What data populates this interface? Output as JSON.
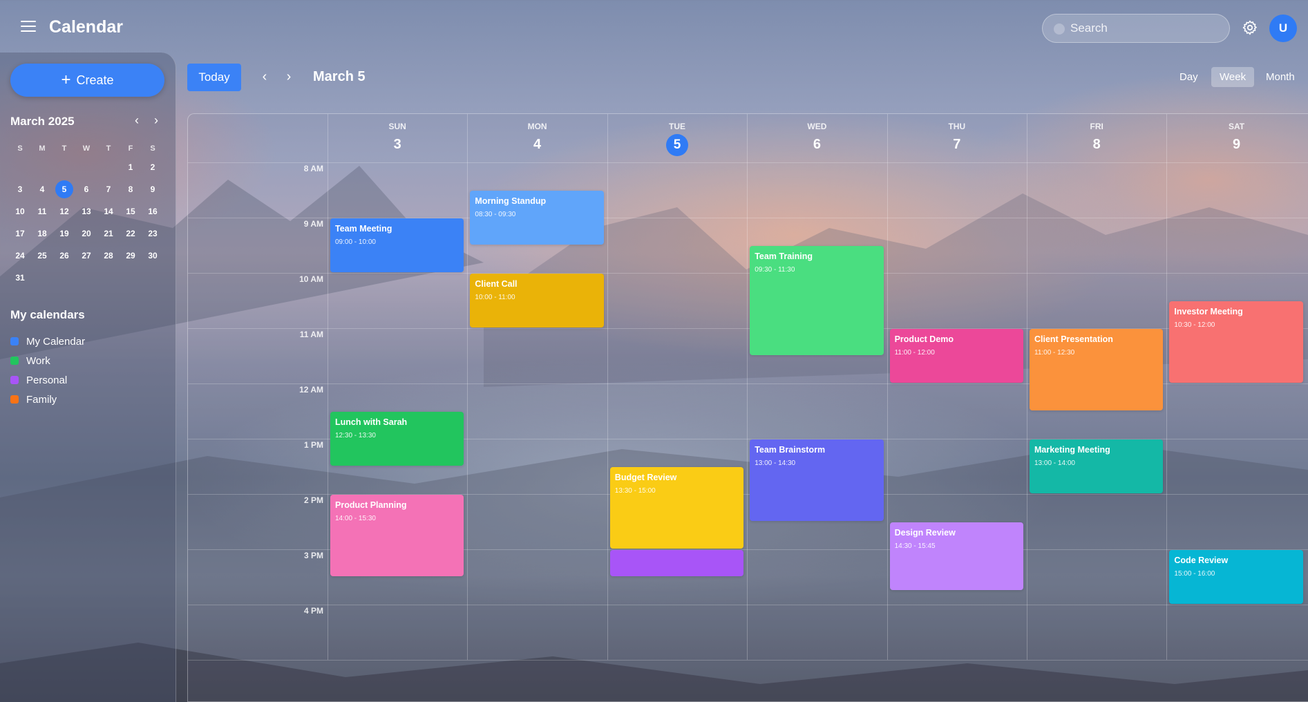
{
  "header": {
    "title": "Calendar",
    "search_placeholder": "Search",
    "avatar_initial": "U"
  },
  "sidebar": {
    "create_label": "Create",
    "mini_calendar": {
      "month_label": "March 2025",
      "weekday_headers": [
        "S",
        "M",
        "T",
        "W",
        "T",
        "F",
        "S"
      ],
      "weeks": [
        [
          "",
          "",
          "",
          "",
          "",
          "1",
          "2"
        ],
        [
          "3",
          "4",
          "5",
          "6",
          "7",
          "8",
          "9"
        ],
        [
          "10",
          "11",
          "12",
          "13",
          "14",
          "15",
          "16"
        ],
        [
          "17",
          "18",
          "19",
          "20",
          "21",
          "22",
          "23"
        ],
        [
          "24",
          "25",
          "26",
          "27",
          "28",
          "29",
          "30"
        ],
        [
          "31",
          "",
          "",
          "",
          "",
          "",
          ""
        ]
      ],
      "selected_day": "5"
    },
    "calendars_title": "My calendars",
    "calendars": [
      {
        "label": "My Calendar",
        "color": "#3b82f6"
      },
      {
        "label": "Work",
        "color": "#22c55e"
      },
      {
        "label": "Personal",
        "color": "#a855f7"
      },
      {
        "label": "Family",
        "color": "#f97316"
      }
    ]
  },
  "toolbar": {
    "today_label": "Today",
    "date_title": "March 5",
    "views": {
      "day": "Day",
      "week": "Week",
      "month": "Month"
    },
    "active_view": "Week"
  },
  "week": {
    "days": [
      {
        "name": "SUN",
        "num": "3"
      },
      {
        "name": "MON",
        "num": "4"
      },
      {
        "name": "TUE",
        "num": "5",
        "today": true
      },
      {
        "name": "WED",
        "num": "6"
      },
      {
        "name": "THU",
        "num": "7"
      },
      {
        "name": "FRI",
        "num": "8"
      },
      {
        "name": "SAT",
        "num": "9"
      }
    ],
    "hours": [
      "8 AM",
      "9 AM",
      "10 AM",
      "11 AM",
      "12 AM",
      "1 PM",
      "2 PM",
      "3 PM",
      "4 PM"
    ]
  },
  "events": [
    {
      "title": "Team Meeting",
      "time": "09:00 - 10:00",
      "day": 0,
      "start": 9.0,
      "end": 10.0,
      "color": "#3b82f6"
    },
    {
      "title": "Lunch with Sarah",
      "time": "12:30 - 13:30",
      "day": 0,
      "start": 12.5,
      "end": 13.5,
      "color": "#22c55e"
    },
    {
      "title": "Product Planning",
      "time": "14:00 - 15:30",
      "day": 0,
      "start": 14.0,
      "end": 15.5,
      "color": "#f472b6"
    },
    {
      "title": "Morning Standup",
      "time": "08:30 - 09:30",
      "day": 1,
      "start": 8.5,
      "end": 9.5,
      "color": "#60a5fa"
    },
    {
      "title": "Client Call",
      "time": "10:00 - 11:00",
      "day": 1,
      "start": 10.0,
      "end": 11.0,
      "color": "#eab308"
    },
    {
      "title": "Budget Review",
      "time": "13:30 - 15:00",
      "day": 2,
      "start": 13.5,
      "end": 15.0,
      "color": "#facc15"
    },
    {
      "title": "",
      "time": "",
      "day": 2,
      "start": 15.0,
      "end": 15.5,
      "color": "#a855f7"
    },
    {
      "title": "Team Training",
      "time": "09:30 - 11:30",
      "day": 3,
      "start": 9.5,
      "end": 11.5,
      "color": "#4ade80"
    },
    {
      "title": "Team Brainstorm",
      "time": "13:00 - 14:30",
      "day": 3,
      "start": 13.0,
      "end": 14.5,
      "color": "#6366f1"
    },
    {
      "title": "Product Demo",
      "time": "11:00 - 12:00",
      "day": 4,
      "start": 11.0,
      "end": 12.0,
      "color": "#ec4899"
    },
    {
      "title": "Design Review",
      "time": "14:30 - 15:45",
      "day": 4,
      "start": 14.5,
      "end": 15.75,
      "color": "#c084fc"
    },
    {
      "title": "Client Presentation",
      "time": "11:00 - 12:30",
      "day": 5,
      "start": 11.0,
      "end": 12.5,
      "color": "#fb923c"
    },
    {
      "title": "Marketing Meeting",
      "time": "13:00 - 14:00",
      "day": 5,
      "start": 13.0,
      "end": 14.0,
      "color": "#14b8a6"
    },
    {
      "title": "Investor Meeting",
      "time": "10:30 - 12:00",
      "day": 6,
      "start": 10.5,
      "end": 12.0,
      "color": "#f87171"
    },
    {
      "title": "Code Review",
      "time": "15:00 - 16:00",
      "day": 6,
      "start": 15.0,
      "end": 16.0,
      "color": "#06b6d4"
    }
  ]
}
